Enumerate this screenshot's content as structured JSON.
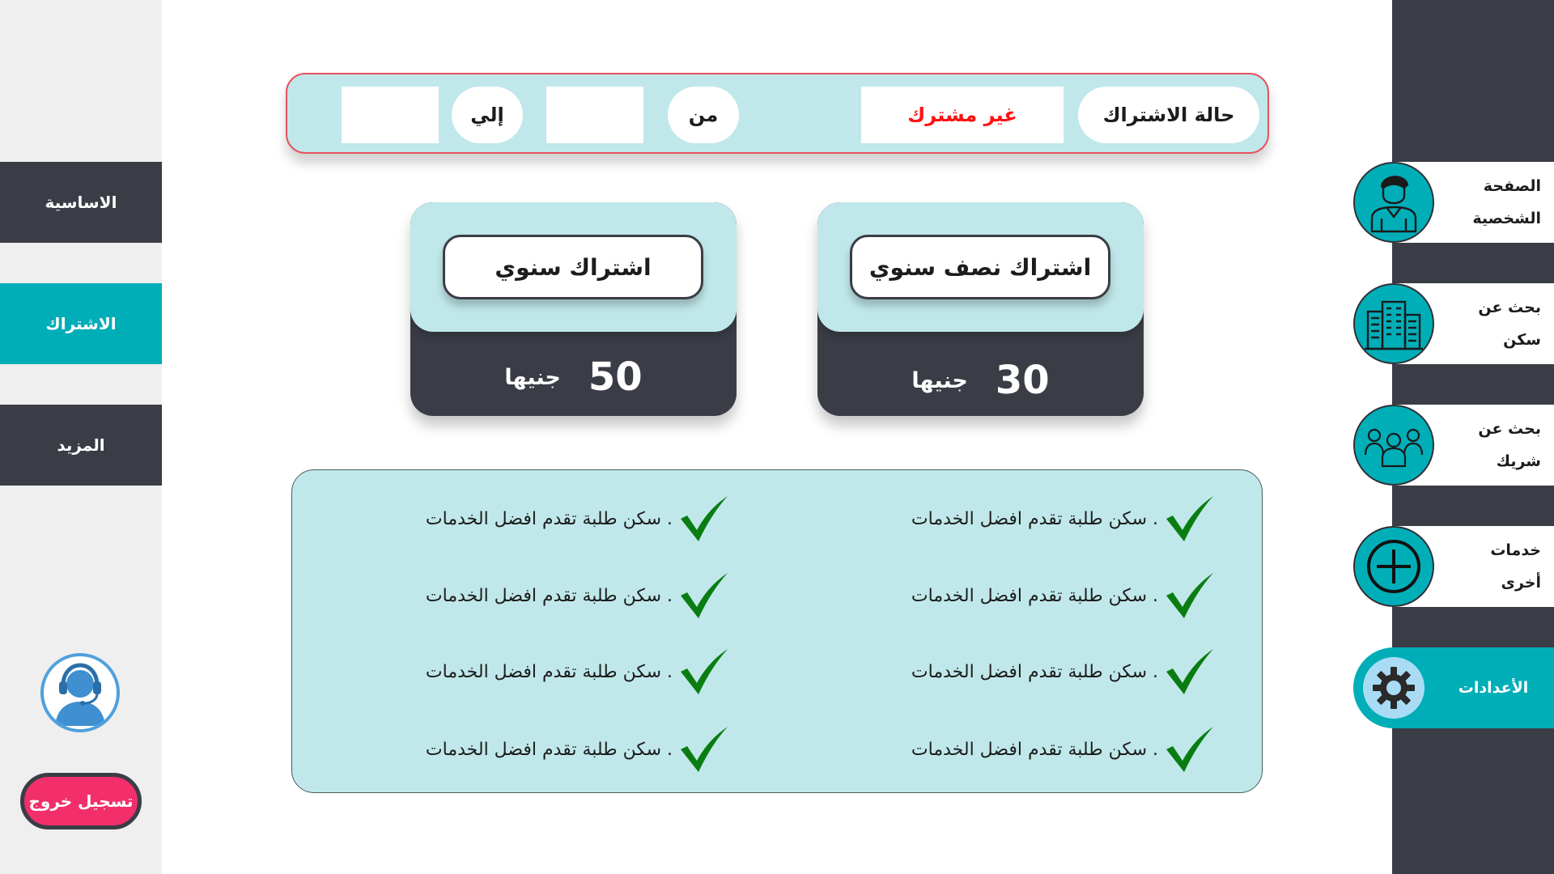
{
  "left_nav": {
    "items": [
      {
        "label": "الاساسية",
        "active": false
      },
      {
        "label": "الاشتراك",
        "active": true
      },
      {
        "label": "المزيد",
        "active": false
      }
    ],
    "support_icon": "headset-support-icon",
    "logout_label": "تسجيل خروج"
  },
  "right_nav": {
    "items": [
      {
        "label": "الصفحة الشخصية",
        "icon": "user-profile-icon",
        "active": false
      },
      {
        "label": "بحث عن سكن",
        "icon": "building-icon",
        "active": false
      },
      {
        "label": "بحث عن شريك",
        "icon": "group-users-icon",
        "active": false
      },
      {
        "label": "خدمات أخرى",
        "icon": "plus-circle-icon",
        "active": false
      },
      {
        "label": "الأعدادات",
        "icon": "gear-icon",
        "active": true
      }
    ]
  },
  "status": {
    "label": "حالة الاشتراك",
    "value": "غير مشترك",
    "from_label": "من",
    "from_value": "",
    "to_label": "إلي",
    "to_value": ""
  },
  "plans": [
    {
      "name": "اشتراك سنوي",
      "amount": "50",
      "currency": "جنيها"
    },
    {
      "name": "اشتراك نصف سنوي",
      "amount": "30",
      "currency": "جنيها"
    }
  ],
  "features": {
    "left": [
      ". سكن طلبة تقدم افضل الخدمات",
      ". سكن طلبة تقدم افضل الخدمات",
      ". سكن طلبة تقدم افضل الخدمات",
      ". سكن طلبة تقدم افضل الخدمات"
    ],
    "right": [
      ". سكن طلبة تقدم افضل الخدمات",
      ". سكن طلبة تقدم افضل الخدمات",
      ". سكن طلبة تقدم افضل الخدمات",
      ". سكن طلبة تقدم افضل الخدمات"
    ],
    "check_icon": "checkmark-icon"
  },
  "colors": {
    "teal": "#00aeb8",
    "light_teal": "#c0e8ea",
    "dark": "#3a3d46",
    "logout": "#f22e6b",
    "status_value": "#ff1111",
    "check": "#0a7d12"
  }
}
